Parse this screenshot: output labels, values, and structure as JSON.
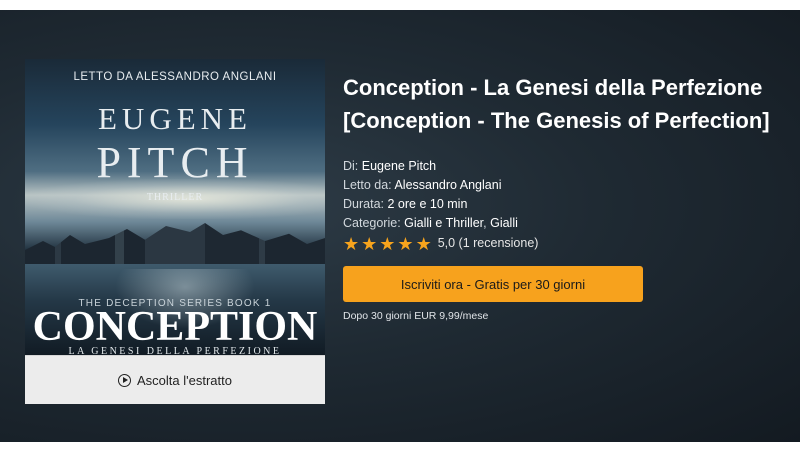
{
  "cover": {
    "narrator_line": "LETTO DA ALESSANDRO ANGLANI",
    "author_first": "EUGENE",
    "author_last": "PITCH",
    "genre": "THRILLER",
    "series": "THE DECEPTION SERIES BOOK 1",
    "title": "CONCEPTION",
    "subtitle": "LA GENESI DELLA PERFEZIONE"
  },
  "sample": {
    "label": "Ascolta l'estratto",
    "icon": "play-circle-icon"
  },
  "book": {
    "title": "Conception - La Genesi della Perfezione [Conception - The Genesis of Perfection]",
    "author_label": "Di:",
    "author": "Eugene Pitch",
    "narrator_label": "Letto da:",
    "narrator": "Alessandro Anglani",
    "duration_label": "Durata:",
    "duration": "2 ore e 10 min",
    "categories_label": "Categorie:",
    "category_1": "Gialli e Thriller",
    "category_separator": ",",
    "category_2": "Gialli",
    "rating_stars": 5,
    "rating_text": "5,0 (1 recensione)"
  },
  "cta": {
    "label": "Iscriviti ora - Gratis per 30 giorni",
    "price_note": "Dopo 30 giorni EUR 9,99/mese"
  },
  "colors": {
    "accent": "#f7a21d",
    "star": "#f7a41d",
    "hero_bg": "#1f2a33"
  }
}
